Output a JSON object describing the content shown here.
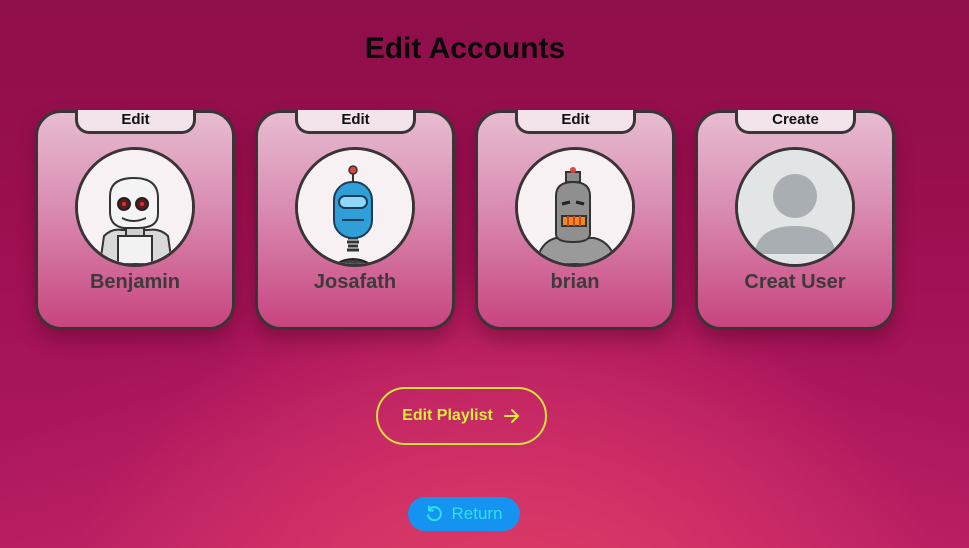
{
  "page": {
    "title": "Edit Accounts"
  },
  "accounts": [
    {
      "action": "Edit",
      "name": "Benjamin",
      "avatar_icon": "white-robot-avatar-icon"
    },
    {
      "action": "Edit",
      "name": "Josafath",
      "avatar_icon": "blue-robot-avatar-icon"
    },
    {
      "action": "Edit",
      "name": "brian",
      "avatar_icon": "grey-robot-avatar-icon"
    },
    {
      "action": "Create",
      "name": "Creat User",
      "avatar_icon": "default-user-avatar-icon"
    }
  ],
  "buttons": {
    "edit_playlist": "Edit Playlist",
    "return": "Return"
  },
  "colors": {
    "background": "#9a0f4e",
    "card_border": "#3b3437",
    "playlist_accent": "#d4e33a",
    "return_bg": "#1593f0",
    "return_text": "#2fe0ee"
  }
}
